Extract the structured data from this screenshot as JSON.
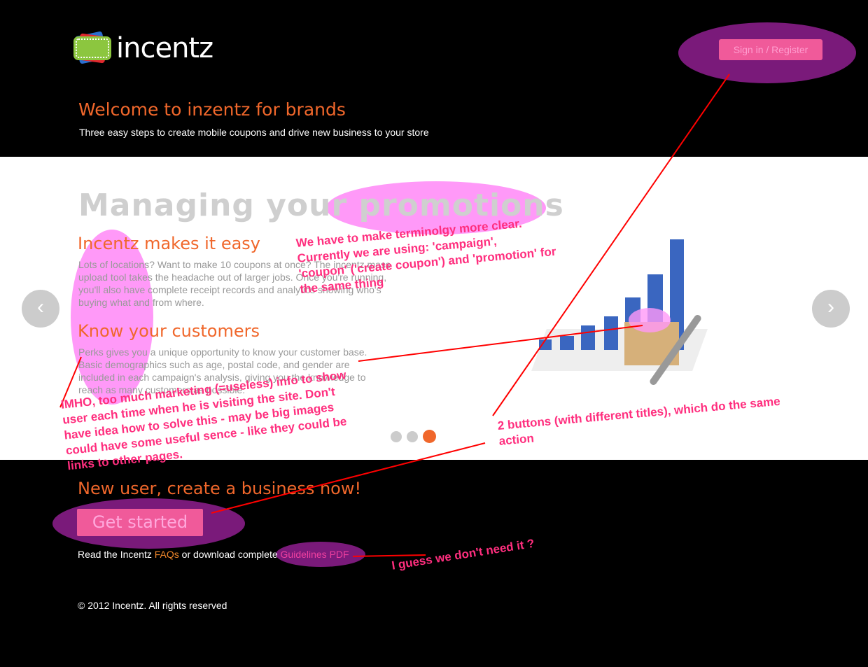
{
  "header": {
    "logo_text": "incentz",
    "signin_label": "Sign in / Register",
    "welcome": "Welcome to inzentz for brands",
    "tagline": "Three easy steps to create mobile coupons and drive new business to your store"
  },
  "slide": {
    "headline": "Managing your promotions",
    "sections": [
      {
        "title": "Incentz makes it easy",
        "body": "Lots of locations? Want to make 10 coupons at once? The incentz mass upload tool takes the headache out of larger jobs. Once you're running, you'll also have complete receipt records and analytics showing who's buying what and from where."
      },
      {
        "title": "Know your customers",
        "body": "Perks gives you a unique opportunity to know your customer base. Basic demographics such as age, postal code, and gender are included in each campaign's analysis, giving you the knowledge to reach as many customers as possible."
      }
    ],
    "prev": "‹",
    "next": "›",
    "active_dot": 3,
    "dot_count": 3
  },
  "cta": {
    "title": "New user, create a business now!",
    "button": "Get started",
    "read_prefix": "Read the Incentz ",
    "faqs": "FAQs",
    "read_middle": " or download complete ",
    "pdf": "Guidelines PDF"
  },
  "footer": {
    "copyright": "© 2012 Incentz. All rights reserved"
  },
  "annotations": {
    "terminology": [
      "We have to make terminolgy more clear.",
      "Currently we are using: 'campaign',",
      "'coupon' ('create coupon') and 'promotion' for",
      "the same thing"
    ],
    "marketing": [
      "IMHO, too much marketing (=useless) info to show",
      "user each time when he is visiting the site. Don't",
      "have idea how to solve this - may be big images",
      "could have some useful sence - like they could be",
      "links to other pages."
    ],
    "buttons": [
      "2 buttons (with different titles), which do the same",
      "action"
    ],
    "pdf": "I guess we don't need it ?"
  }
}
